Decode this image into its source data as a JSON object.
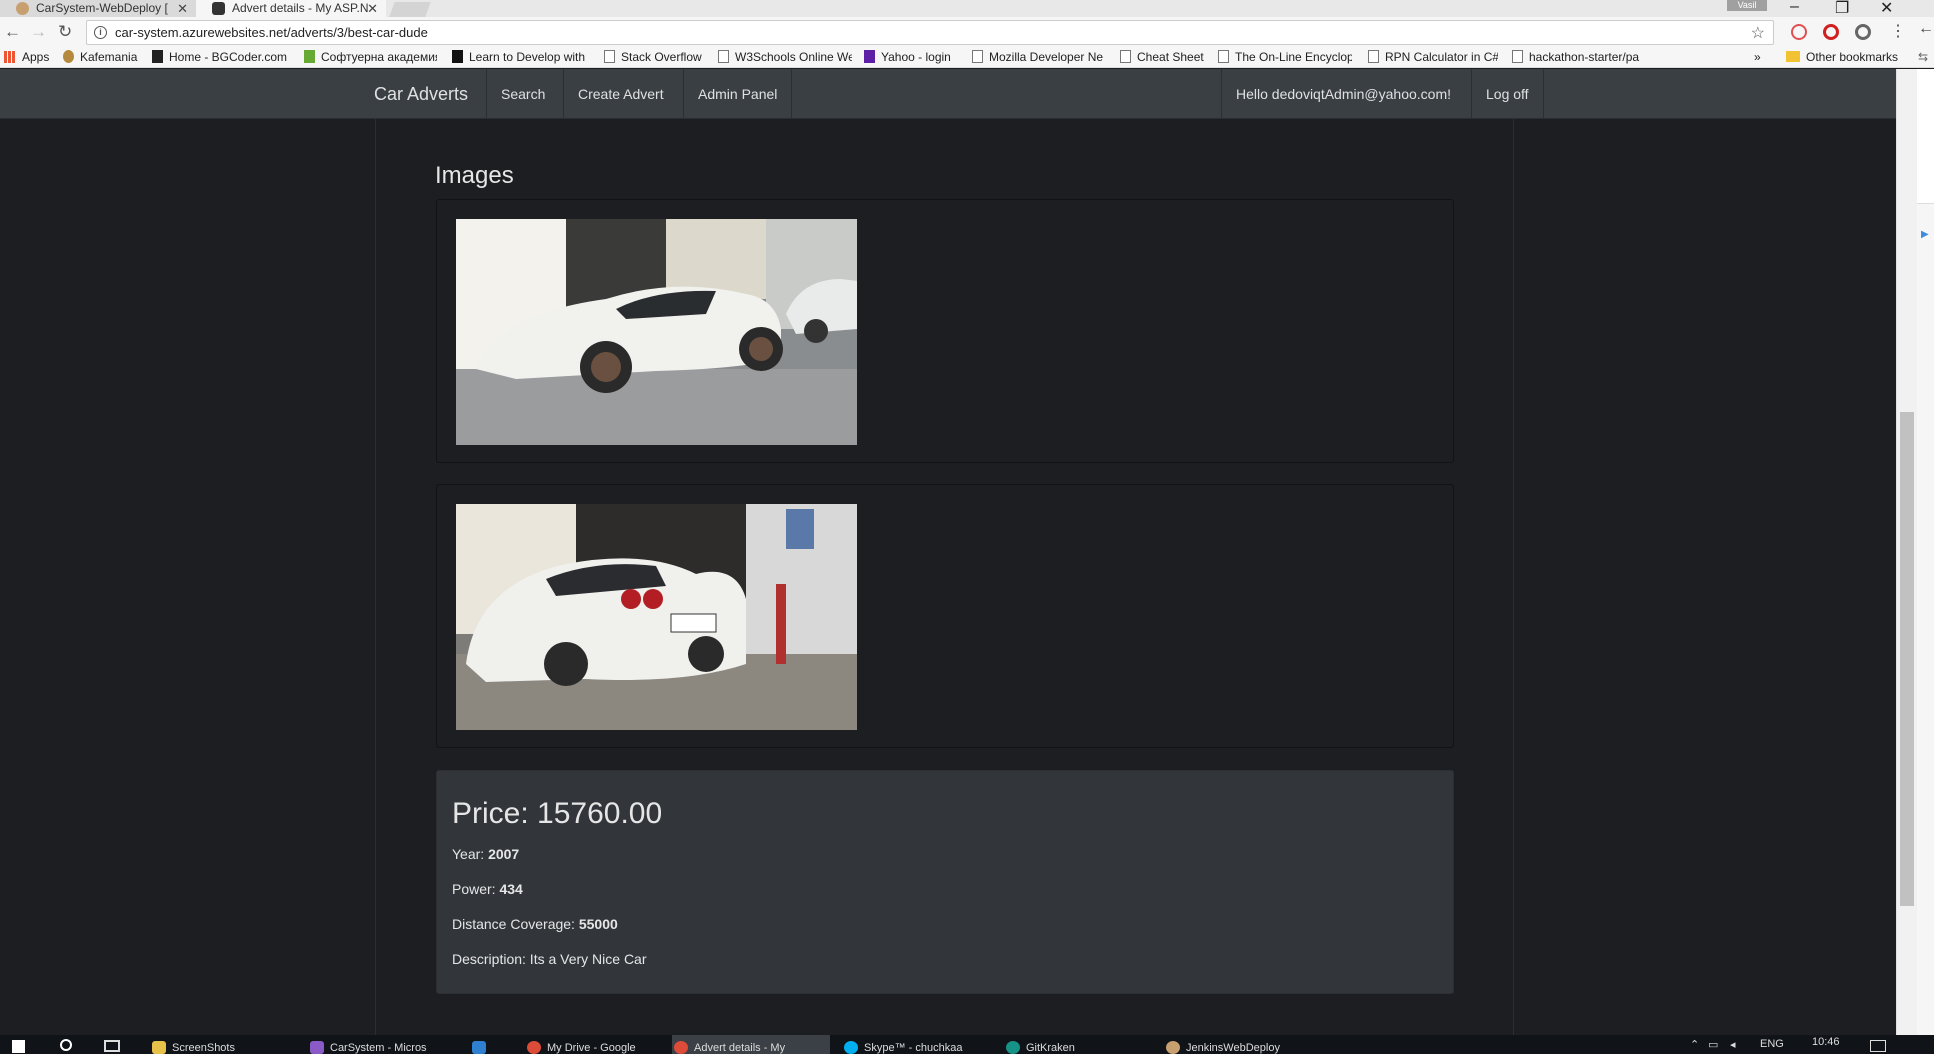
{
  "browser": {
    "tabs": [
      {
        "title": "CarSystem-WebDeploy ["
      },
      {
        "title": "Advert details - My ASP.N"
      }
    ],
    "user_chip": "Vasil",
    "url": "car-system.azurewebsites.net/adverts/3/best-car-dude",
    "bookmarks_apps": "Apps",
    "bookmarks": [
      "Kafemania",
      "Home - BGCoder.com",
      "Софтуерна академия",
      "Learn to Develop with",
      "Stack Overflow",
      "W3Schools Online We",
      "Yahoo - login",
      "Mozilla Developer Ne",
      "Cheat Sheet",
      "The On-Line Encyclop",
      "RPN Calculator in C#",
      "hackathon-starter/pa"
    ],
    "bookmarks_more": "»",
    "other_bookmarks": "Other bookmarks"
  },
  "navbar": {
    "brand": "Car Adverts",
    "links": [
      "Search",
      "Create Advert",
      "Admin Panel"
    ],
    "greeting": "Hello dedoviqtAdmin@yahoo.com!",
    "logoff": "Log off"
  },
  "images": {
    "heading": "Images"
  },
  "details": {
    "price": "Price: 15760.00",
    "year_label": "Year: ",
    "year": "2007",
    "power_label": "Power: ",
    "power": "434",
    "distance_label": "Distance Coverage: ",
    "distance": "55000",
    "description": "Description: Its a Very Nice Car"
  },
  "taskbar": {
    "items": [
      "ScreenShots",
      "CarSystem - Micros",
      "",
      "My Drive - Google",
      "Advert details - My",
      "Skype™ - chuchkaa",
      "GitKraken",
      "JenkinsWebDeploy"
    ],
    "lang": "ENG",
    "time": "10:46"
  }
}
